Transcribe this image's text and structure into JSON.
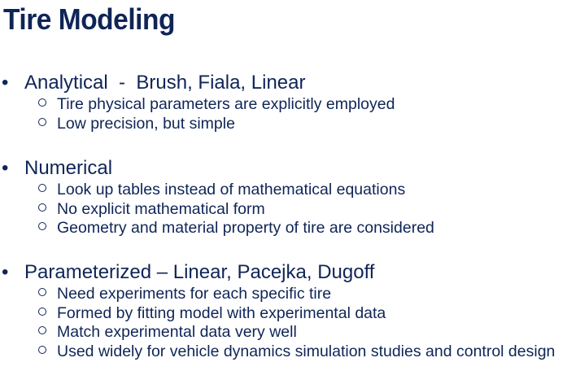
{
  "title": "Tire Modeling",
  "sections": [
    {
      "heading": "Analytical  -  Brush, Fiala, Linear",
      "items": [
        "Tire physical parameters are explicitly employed",
        "Low precision, but simple"
      ]
    },
    {
      "heading": "Numerical",
      "items": [
        "Look up tables instead of mathematical equations",
        "No explicit mathematical form",
        "Geometry and material property of tire are considered"
      ]
    },
    {
      "heading": "Parameterized – Linear, Pacejka, Dugoff",
      "items": [
        "Need experiments for each specific tire",
        "Formed by fitting model with experimental data",
        "Match experimental data very well",
        "Used widely for vehicle dynamics simulation studies and control design"
      ]
    }
  ]
}
